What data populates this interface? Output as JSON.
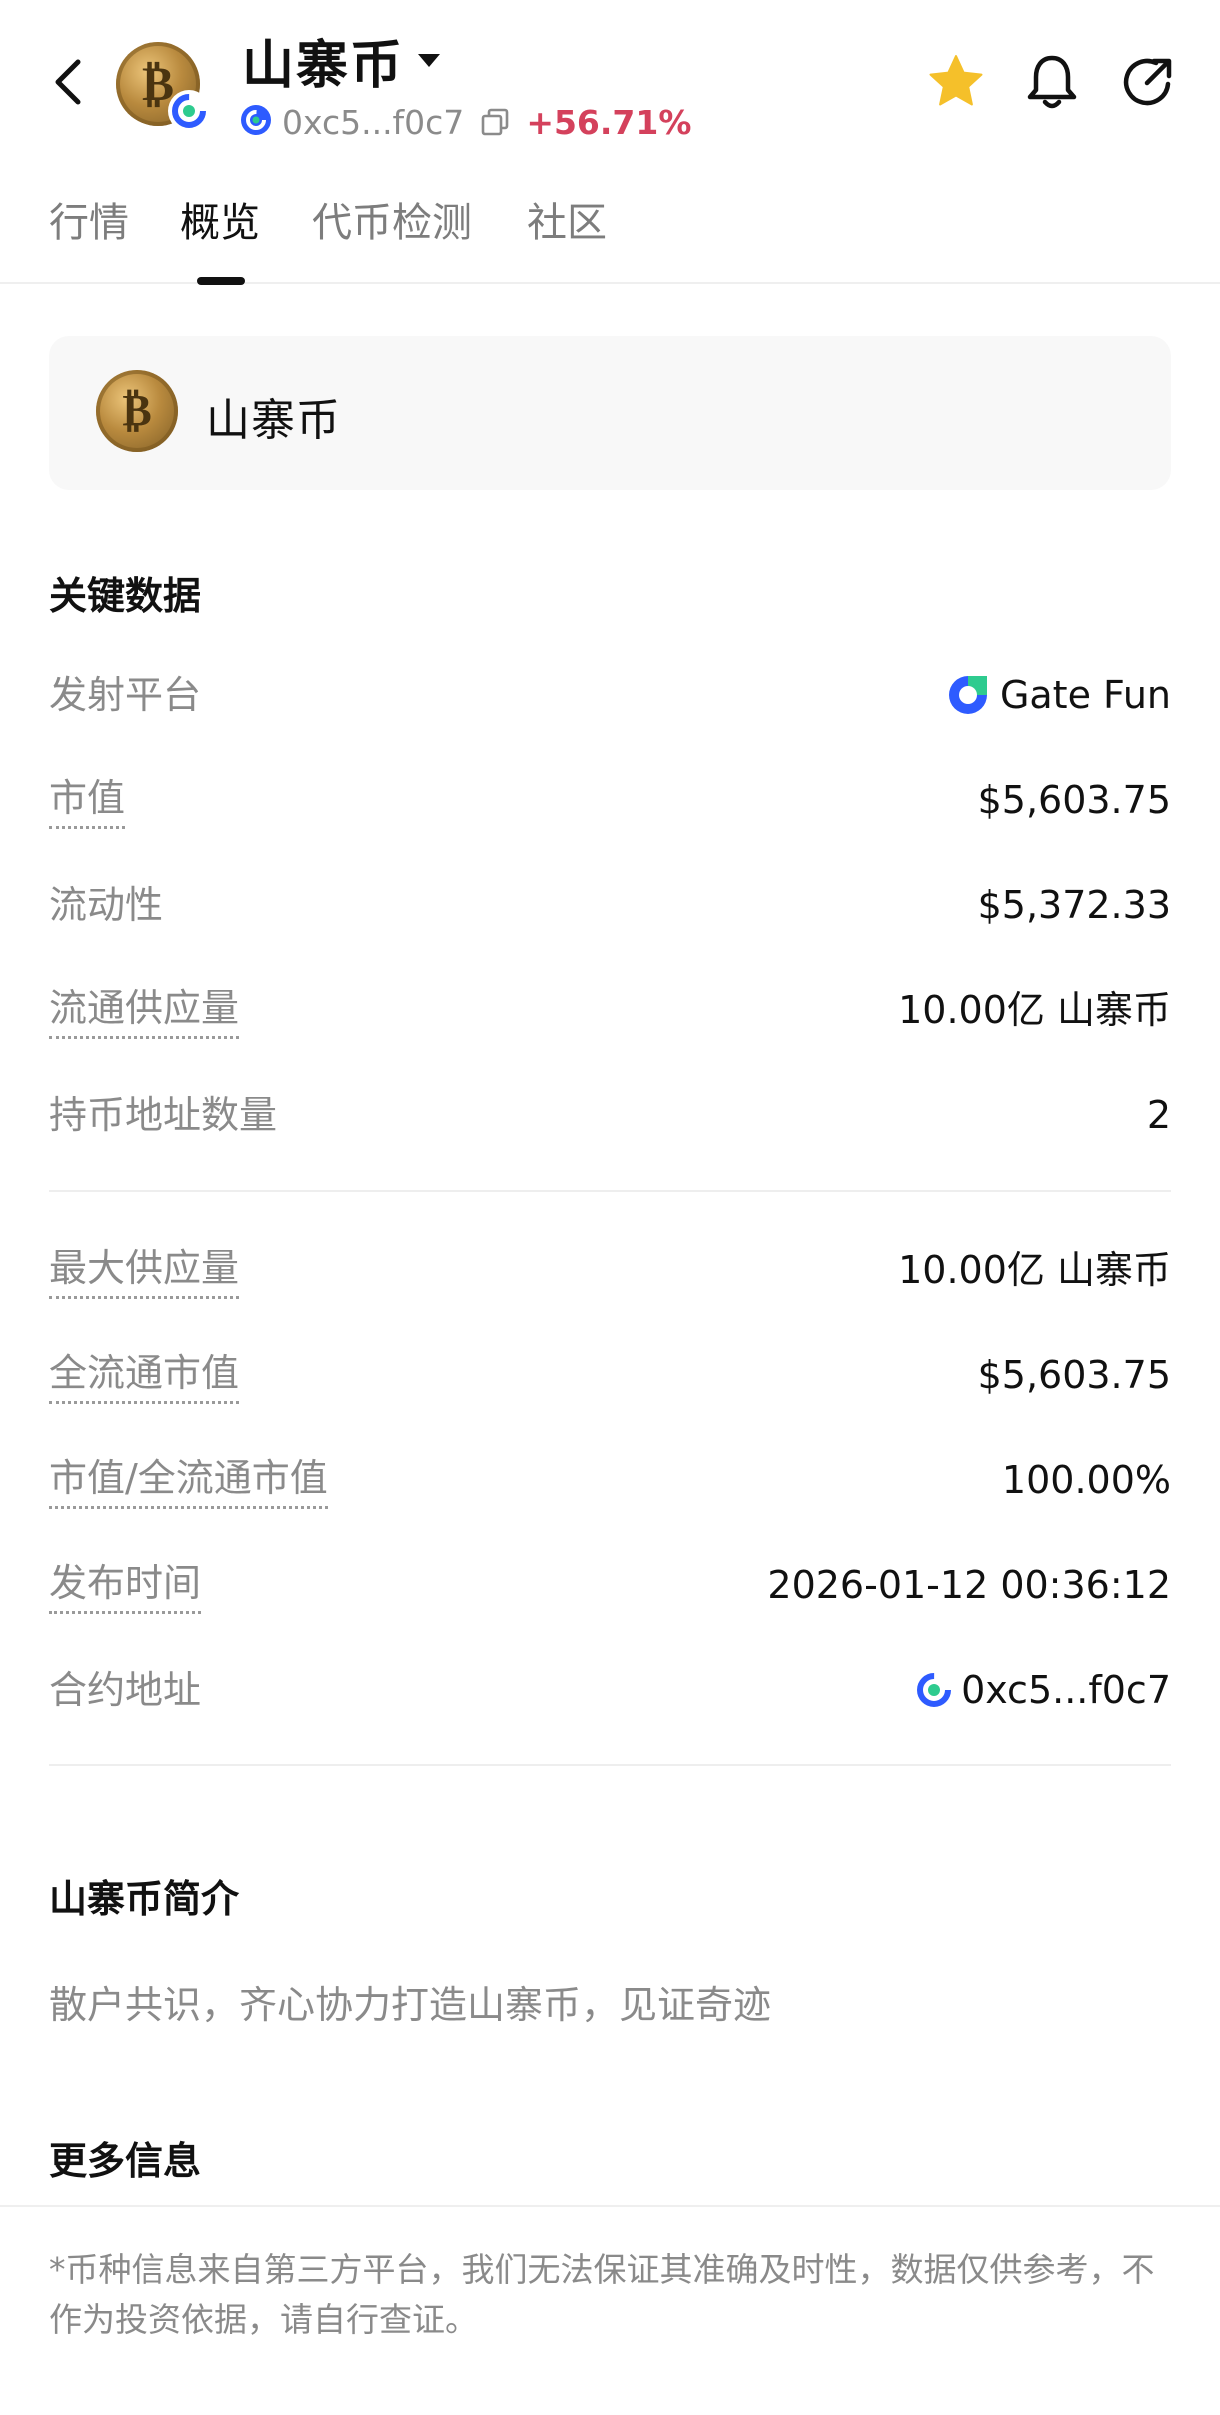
{
  "header": {
    "token_name": "山寨币",
    "contract_short": "0xc5...f0c7",
    "price_change": "+56.71%",
    "avatar_glyph": "₿",
    "icons": [
      "back-arrow-icon",
      "caret-down-icon",
      "chain-logo-icon",
      "copy-icon",
      "star-icon",
      "bell-icon",
      "share-icon"
    ],
    "star_color": "#f5c02a",
    "change_color": "#d4415c"
  },
  "tabs": [
    {
      "label": "行情",
      "active": false
    },
    {
      "label": "概览",
      "active": true
    },
    {
      "label": "代币检测",
      "active": false
    },
    {
      "label": "社区",
      "active": false
    }
  ],
  "token_card": {
    "name": "山寨币",
    "avatar_glyph": "₿"
  },
  "key_data": {
    "title": "关键数据",
    "rows": [
      {
        "label": "发射平台",
        "value": "Gate Fun",
        "icon": "gate-fun-logo-icon"
      },
      {
        "label": "市值",
        "value": "$5,603.75"
      },
      {
        "label": "流动性",
        "value": "$5,372.33"
      },
      {
        "label": "流通供应量",
        "value": "10.00亿 山寨币"
      },
      {
        "label": "持币地址数量",
        "value": "2"
      },
      {
        "label": "最大供应量",
        "value": "10.00亿 山寨币"
      },
      {
        "label": "全流通市值",
        "value": "$5,603.75"
      },
      {
        "label": "市值/全流通市值",
        "value": "100.00%"
      },
      {
        "label": "发布时间",
        "value": "2026-01-12 00:36:12"
      },
      {
        "label": "合约地址",
        "value": "0xc5...f0c7",
        "icon": "chain-logo-icon"
      }
    ]
  },
  "intro": {
    "title": "山寨币简介",
    "text": "散户共识，齐心协力打造山寨币，见证奇迹"
  },
  "more_info": {
    "title": "更多信息"
  },
  "disclaimer": "*币种信息来自第三方平台，我们无法保证其准确及时性，数据仅供参考，不作为投资依据，请自行查证。",
  "colors": {
    "brand_blue": "#2e5bff",
    "text_primary": "#111111",
    "text_secondary": "#8a8a8a"
  }
}
